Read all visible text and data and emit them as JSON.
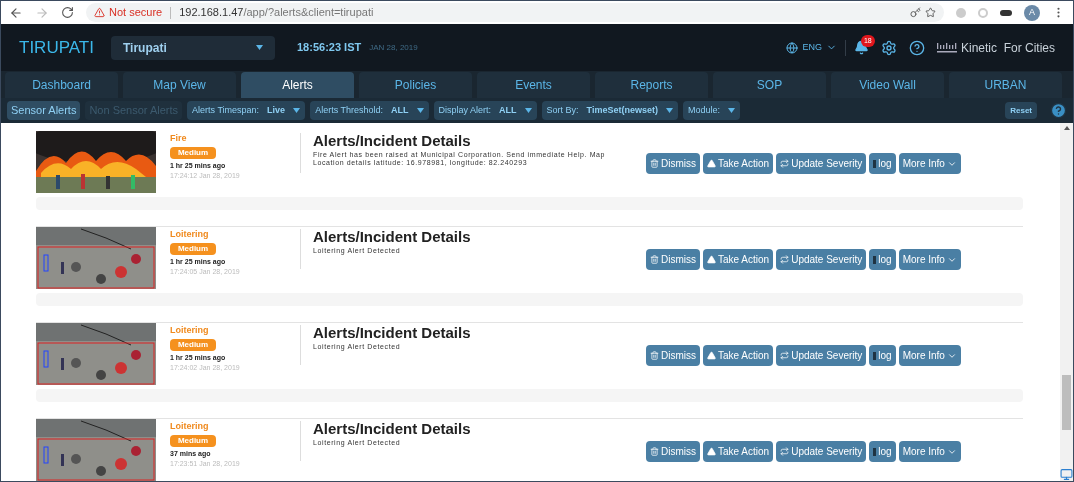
{
  "browser": {
    "security": "Not secure",
    "url_host": "192.168.1.47",
    "url_path": "/app/?alerts&client=tirupati",
    "profile": "A"
  },
  "header": {
    "logo": "TIRUPATI",
    "city": "Tirupati",
    "time": "18:56:23 IST",
    "date": "JAN 28, 2019",
    "language": "ENG",
    "notifications": "18",
    "brand": "Kinetic  For Cities"
  },
  "tabs": [
    {
      "label": "Dashboard",
      "selected": false
    },
    {
      "label": "Map View",
      "selected": false
    },
    {
      "label": "Alerts",
      "selected": true
    },
    {
      "label": "Policies",
      "selected": false
    },
    {
      "label": "Events",
      "selected": false
    },
    {
      "label": "Reports",
      "selected": false
    },
    {
      "label": "SOP",
      "selected": false
    },
    {
      "label": "Video Wall",
      "selected": false
    },
    {
      "label": "URBAN",
      "selected": false
    }
  ],
  "filters": {
    "alert_groups": [
      {
        "label": "Sensor Alerts",
        "selected": true
      },
      {
        "label": "Non Sensor Alerts",
        "selected": false
      }
    ],
    "dropdowns": [
      {
        "label": "Alerts Timespan:",
        "value": "Live"
      },
      {
        "label": "Alerts Threshold:",
        "value": "ALL"
      },
      {
        "label": "Display Alert:",
        "value": "ALL"
      },
      {
        "label": "Sort By:",
        "value": "TimeSet(newset)"
      },
      {
        "label": "Module:"
      }
    ],
    "reset": "Reset"
  },
  "alerts": [
    {
      "type": "Fire",
      "severity": "Medium",
      "ago": "1 hr 25 mins ago",
      "timestamp": "17:24:12 Jan 28, 2019",
      "title": "Alerts/Incident Details",
      "message": "Fire Alert has been raised at Municipal Corporation. Send immediate Help. Map Location details latitude: 16.978981, longitude: 82.240293",
      "actions": [
        {
          "kind": "dismiss",
          "label": "Dismiss"
        },
        {
          "kind": "action",
          "label": "Take Action"
        },
        {
          "kind": "severity",
          "label": "Update Severity"
        },
        {
          "kind": "log",
          "label": "log"
        },
        {
          "kind": "more",
          "label": "More Info"
        }
      ]
    },
    {
      "type": "Loitering",
      "severity": "Medium",
      "ago": "1 hr 25 mins ago",
      "timestamp": "17:24:05 Jan 28, 2019",
      "title": "Alerts/Incident Details",
      "message": "Loitering Alert Detected",
      "actions": [
        {
          "kind": "dismiss",
          "label": "Dismiss"
        },
        {
          "kind": "action",
          "label": "Take Action"
        },
        {
          "kind": "severity",
          "label": "Update Severity"
        },
        {
          "kind": "log",
          "label": "log"
        },
        {
          "kind": "more",
          "label": "More Info"
        }
      ]
    },
    {
      "type": "Loitering",
      "severity": "Medium",
      "ago": "1 hr 25 mins ago",
      "timestamp": "17:24:02 Jan 28, 2019",
      "title": "Alerts/Incident Details",
      "message": "Loitering Alert Detected",
      "actions": [
        {
          "kind": "dismiss",
          "label": "Dismiss"
        },
        {
          "kind": "action",
          "label": "Take Action"
        },
        {
          "kind": "severity",
          "label": "Update Severity"
        },
        {
          "kind": "log",
          "label": "log"
        },
        {
          "kind": "more",
          "label": "More Info"
        }
      ]
    },
    {
      "type": "Loitering",
      "severity": "Medium",
      "ago": "37 mins ago",
      "timestamp": "17:23:51 Jan 28, 2019",
      "title": "Alerts/Incident Details",
      "message": "Loitering Alert Detected",
      "actions": [
        {
          "kind": "dismiss",
          "label": "Dismiss"
        },
        {
          "kind": "action",
          "label": "Take Action"
        },
        {
          "kind": "severity",
          "label": "Update Severity"
        },
        {
          "kind": "log",
          "label": "log"
        },
        {
          "kind": "more",
          "label": "More Info"
        }
      ]
    }
  ]
}
